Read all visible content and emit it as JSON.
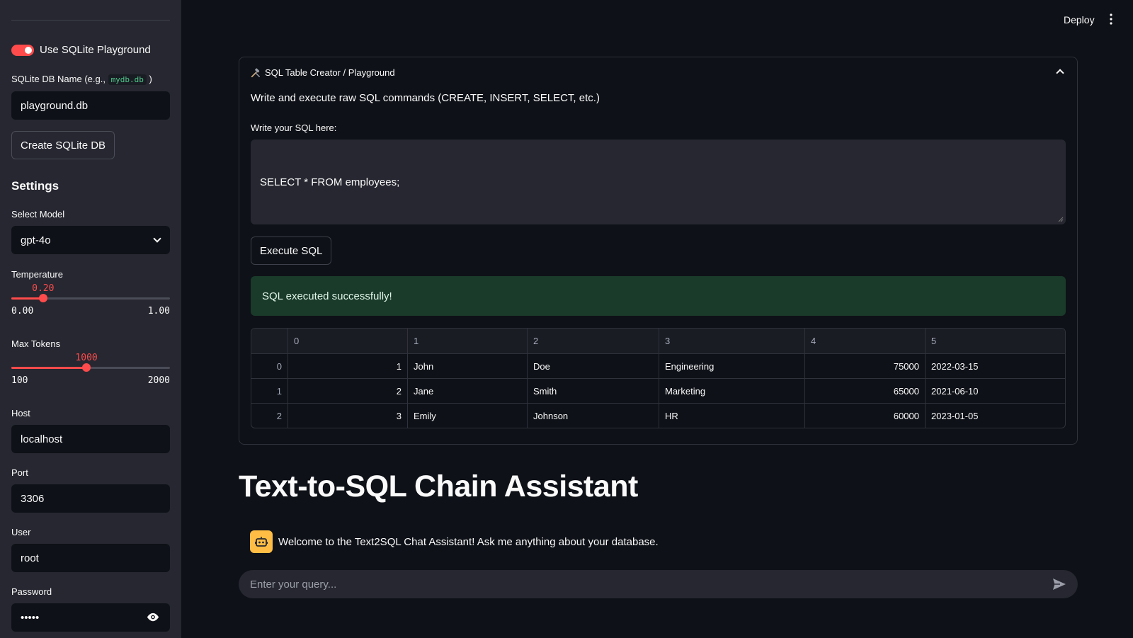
{
  "sidebar": {
    "toggle_label": "Use SQLite Playground",
    "db_name_label_prefix": "SQLite DB Name (e.g., ",
    "db_name_label_code": "mydb.db",
    "db_name_label_suffix": ")",
    "db_name_value": "playground.db",
    "create_db_button": "Create SQLite DB",
    "settings_heading": "Settings",
    "model_label": "Select Model",
    "model_value": "gpt-4o",
    "temperature": {
      "label": "Temperature",
      "value": "0.20",
      "min": "0.00",
      "max": "1.00",
      "fraction": 0.2
    },
    "max_tokens": {
      "label": "Max Tokens",
      "value": "1000",
      "min": "100",
      "max": "2000",
      "fraction": 0.4737
    },
    "host_label": "Host",
    "host_value": "localhost",
    "port_label": "Port",
    "port_value": "3306",
    "user_label": "User",
    "user_value": "root",
    "password_label": "Password",
    "password_value": "•••••"
  },
  "header": {
    "deploy_label": "Deploy"
  },
  "expander": {
    "title": "SQL Table Creator / Playground",
    "description": "Write and execute raw SQL commands (CREATE, INSERT, SELECT, etc.)",
    "sql_label": "Write your SQL here:",
    "sql_value": "SELECT * FROM employees;",
    "execute_button": "Execute SQL",
    "success_message": "SQL executed successfully!",
    "table": {
      "columns": [
        "",
        "0",
        "1",
        "2",
        "3",
        "4",
        "5"
      ],
      "rows": [
        [
          "0",
          "1",
          "John",
          "Doe",
          "Engineering",
          "75000",
          "2022-03-15"
        ],
        [
          "1",
          "2",
          "Jane",
          "Smith",
          "Marketing",
          "65000",
          "2021-06-10"
        ],
        [
          "2",
          "3",
          "Emily",
          "Johnson",
          "HR",
          "60000",
          "2023-01-05"
        ]
      ]
    }
  },
  "main": {
    "title": "Text-to-SQL Chain Assistant",
    "bot_message": "Welcome to the Text2SQL Chat Assistant! Ask me anything about your database.",
    "chat_placeholder": "Enter your query..."
  },
  "colors": {
    "accent": "#ff4b4b",
    "success_bg": "#1a3a2a",
    "bot_avatar": "#ffbd45"
  }
}
